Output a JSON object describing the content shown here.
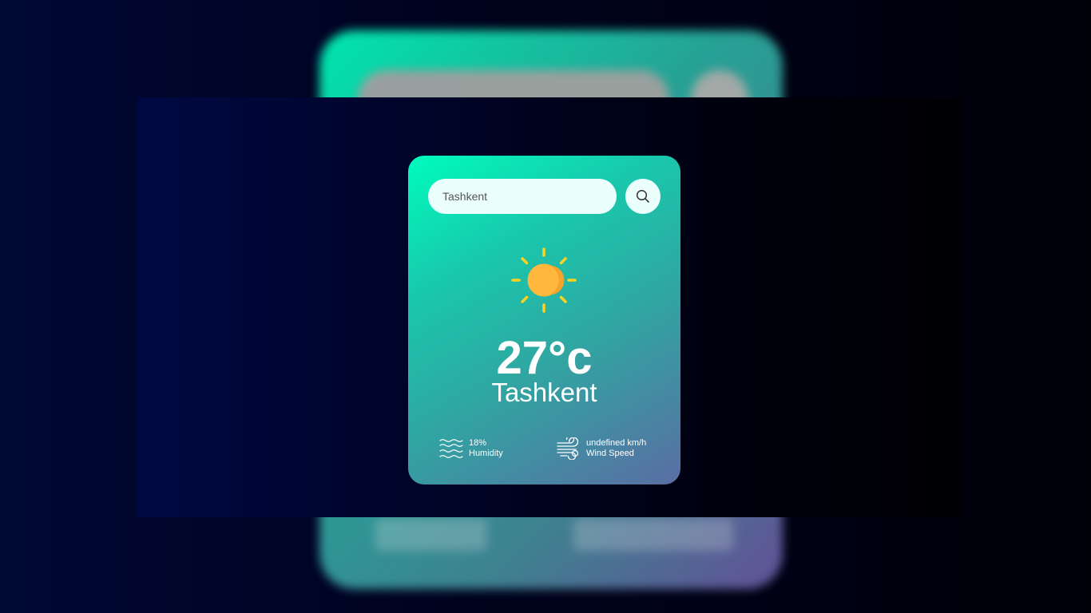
{
  "search": {
    "value": "Tashkent",
    "button_icon": "search-icon"
  },
  "weather": {
    "icon": "sun-icon",
    "temperature": "27°c",
    "city": "Tashkent"
  },
  "details": {
    "humidity": {
      "icon": "humidity-waves-icon",
      "value": "18%",
      "label": "Humidity"
    },
    "wind": {
      "icon": "wind-icon",
      "value": "undefined km/h",
      "label": "Wind Speed"
    }
  },
  "colors": {
    "card_gradient_start": "#00fcbd",
    "card_gradient_end": "#5a6da3",
    "page_background": "#000835",
    "sun_core": "#ffb83b",
    "sun_rays": "#ffd21f",
    "input_background": "#ebfffc"
  }
}
